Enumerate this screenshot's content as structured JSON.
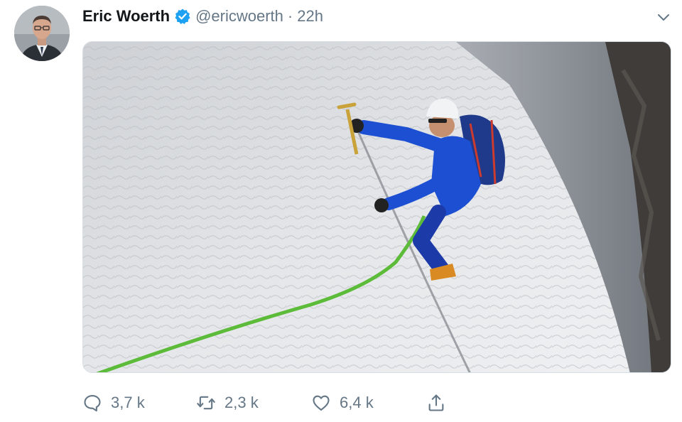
{
  "tweet": {
    "author_name": "Eric Woerth",
    "handle": "@ericwoerth",
    "separator": "·",
    "time": "22h",
    "verified": true
  },
  "actions": {
    "reply_count": "3,7 k",
    "retweet_count": "2,3 k",
    "like_count": "6,4 k"
  },
  "icons": {
    "reply": "speech-bubble-icon",
    "retweet": "retweet-arrows-icon",
    "like": "heart-icon",
    "share": "share-upload-icon",
    "menu": "chevron-down-icon",
    "verified": "verified-badge-icon"
  },
  "colors": {
    "accent": "#1da1f2",
    "muted_text": "#657786",
    "name_text": "#14171a"
  }
}
